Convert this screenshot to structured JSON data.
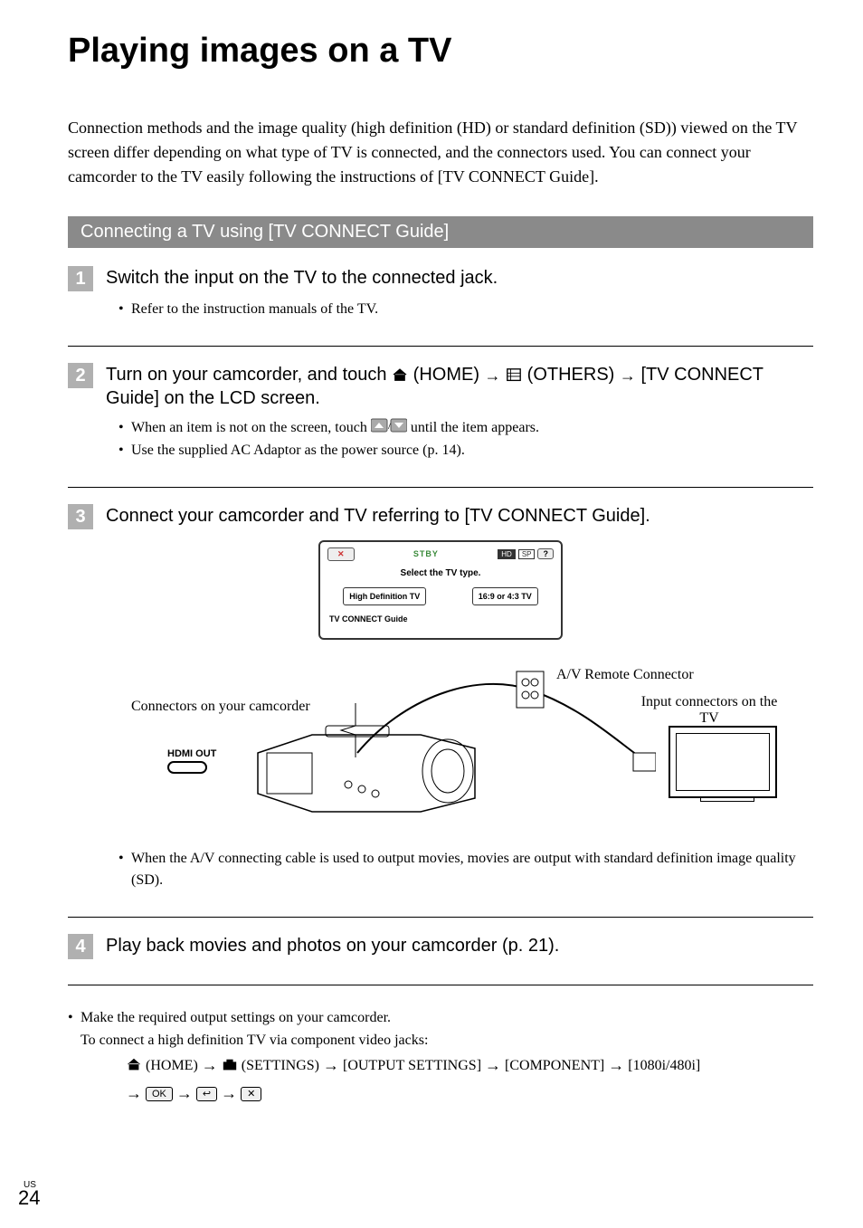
{
  "title": "Playing images on a TV",
  "intro": "Connection methods and the image quality (high definition (HD) or standard definition (SD)) viewed on the TV screen differ depending on what type of TV is connected, and the connectors used. You can connect your camcorder to the TV easily following the instructions of [TV CONNECT Guide].",
  "section_heading": "Connecting a TV using [TV CONNECT Guide]",
  "steps": [
    {
      "num": "1",
      "title": "Switch the input on the TV to the connected jack.",
      "bullets": [
        "Refer to the instruction manuals of the TV."
      ]
    },
    {
      "num": "2",
      "title_parts": {
        "pre": "Turn on your camcorder, and touch ",
        "home": " (HOME) ",
        "others": " (OTHERS) ",
        "post": " [TV CONNECT Guide] on the LCD screen."
      },
      "bullets": [
        "When an item is not on the screen, touch ",
        "Use the supplied AC Adaptor as the power source (p. 14)."
      ],
      "bullet1_suffix": " until the item appears."
    },
    {
      "num": "3",
      "title": "Connect your camcorder and TV referring to [TV CONNECT Guide].",
      "bullets": [
        "When the A/V connecting cable is used to output movies, movies are output with standard definition image quality (SD)."
      ]
    },
    {
      "num": "4",
      "title": "Play back movies and photos on your camcorder (p. 21)."
    }
  ],
  "lcd": {
    "x": "✕",
    "stby": "STBY",
    "hd": "HD",
    "sp": "SP",
    "q": "?",
    "prompt": "Select the TV type.",
    "btn1": "High Definition TV",
    "btn2": "16:9 or 4:3 TV",
    "label": "TV CONNECT Guide"
  },
  "diagram": {
    "connectors_label": "Connectors on your camcorder",
    "av_label": "A/V Remote Connector",
    "tv_label": "Input connectors on the TV",
    "hdmi_label": "HDMI OUT"
  },
  "bottom": {
    "line1": "Make the required output settings on your camcorder.",
    "line2": "To connect a high definition TV via component video jacks:",
    "path": {
      "home": " (HOME) ",
      "settings": " (SETTINGS) ",
      "output": " [OUTPUT SETTINGS] ",
      "component": " [COMPONENT] ",
      "res": " [1080i/480i]",
      "ok": "OK",
      "back": "↩",
      "x": "✕"
    }
  },
  "page": {
    "region": "US",
    "num": "24"
  }
}
